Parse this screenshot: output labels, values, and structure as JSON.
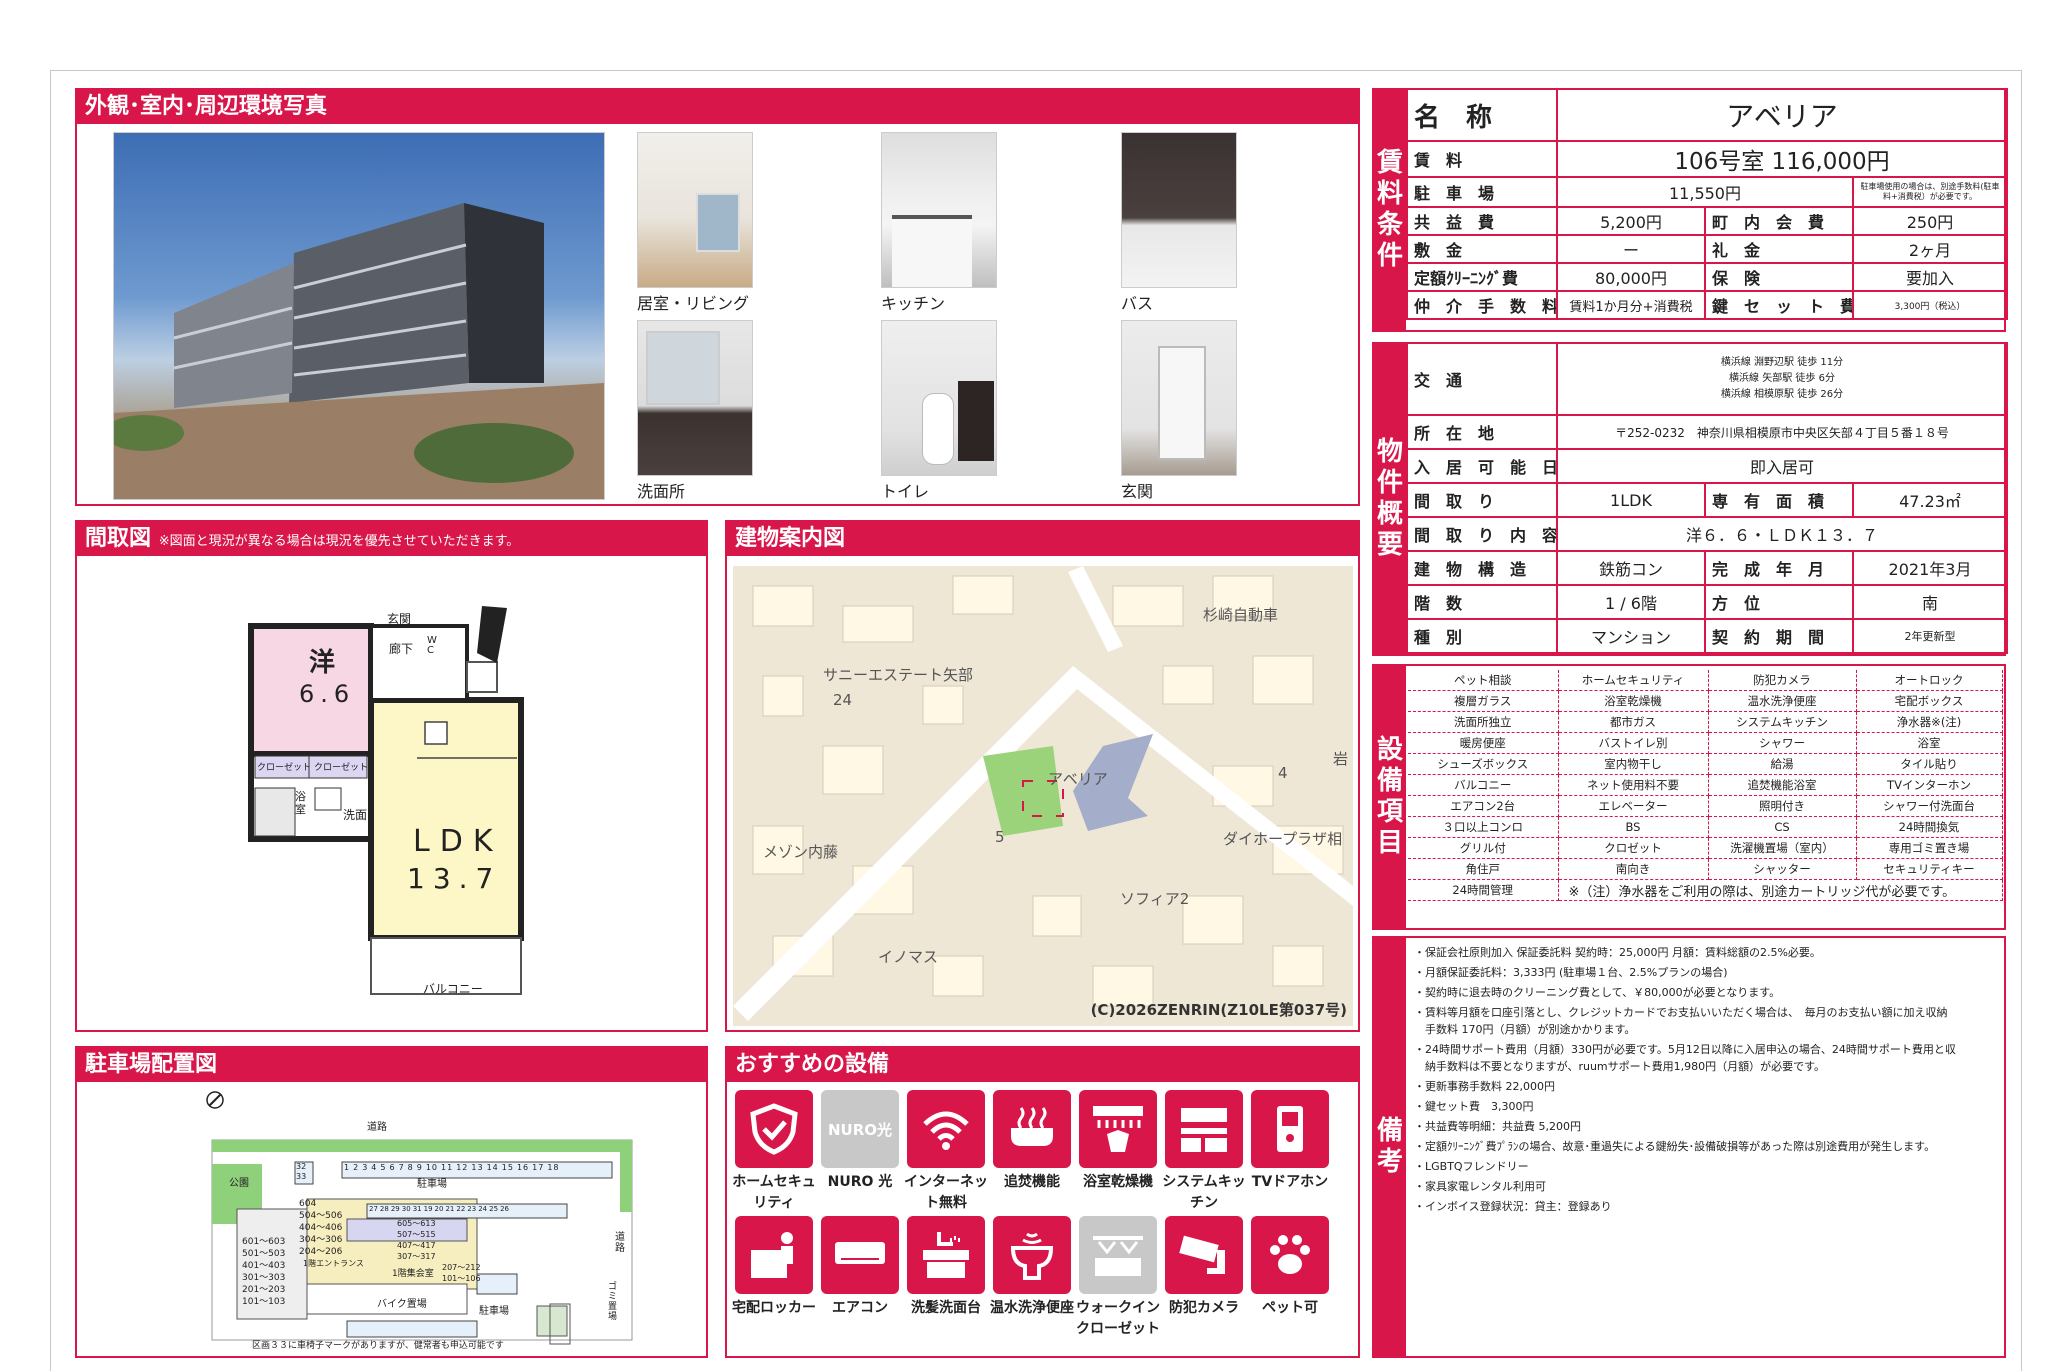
{
  "photos": {
    "title": "外観･室内･周辺環境写真",
    "captions": [
      "居室・リビング",
      "キッチン",
      "バス",
      "洗面所",
      "トイレ",
      "玄関"
    ]
  },
  "floorplan": {
    "title": "間取図",
    "note": "※図面と現況が異なる場合は現況を優先させていただきます。",
    "rooms": {
      "western": "洋",
      "western_size": "6.6",
      "genkan": "玄関",
      "hallway": "廊下",
      "wc": "W C",
      "closet1": "クローゼット",
      "closet2": "クローゼット",
      "bath": "浴 室",
      "washroom": "洗面",
      "ldk": "LDK",
      "ldk_size": "13.7",
      "balcony": "バルコニー"
    }
  },
  "map": {
    "title": "建物案内図",
    "labels": [
      "杉崎自動車",
      "サニーエステート矢部",
      "24",
      "アベリア",
      "5",
      "4",
      "岩",
      "メゾン内藤",
      "ダイホープラザ相",
      "ソフィア2",
      "イノマス"
    ],
    "copyright": "(C)2026ZENRIN(Z10LE第037号)"
  },
  "parking": {
    "title": "駐車場配置図",
    "labels": [
      "道路",
      "公園",
      "駐車場",
      "道路",
      "バイク置場",
      "駐車場",
      "ゴミ置場",
      "1階集会室",
      "1階エントランス"
    ],
    "units_left": [
      "604",
      "504～506",
      "404～406",
      "304～306",
      "204～206"
    ],
    "units_left2": [
      "601～603",
      "501～503",
      "401～403",
      "301～303",
      "201～203",
      "101～103"
    ],
    "units_mid": [
      "605～613",
      "507～515",
      "407～417",
      "307～317",
      "207～212",
      "101～106"
    ],
    "slots_top": [
      "1",
      "2",
      "3",
      "4",
      "5",
      "6",
      "7",
      "8",
      "9",
      "10",
      "11",
      "12",
      "13",
      "14",
      "15",
      "16",
      "17",
      "18"
    ],
    "slots_side": [
      "32",
      "33"
    ],
    "slots_mid": [
      "27",
      "28",
      "29",
      "30",
      "31",
      "19",
      "20",
      "21",
      "22",
      "23",
      "24",
      "25",
      "26"
    ],
    "note": "区画３３に車椅子マークがありますが、健常者も申込可能です"
  },
  "recommend": {
    "title": "おすすめの設備",
    "items": [
      {
        "label": "ホームセキュリティ",
        "icon": "shield-icon"
      },
      {
        "label": "NURO 光",
        "icon": "nuro-logo-icon",
        "badge": "NURO光"
      },
      {
        "label": "インターネット無料",
        "icon": "wifi-icon"
      },
      {
        "label": "追焚機能",
        "icon": "bathtub-icon"
      },
      {
        "label": "浴室乾燥機",
        "icon": "bathroom-dryer-icon"
      },
      {
        "label": "システムキッチン",
        "icon": "kitchen-icon"
      },
      {
        "label": "TVドアホン",
        "icon": "intercom-icon"
      },
      {
        "label": "宅配ロッカー",
        "icon": "delivery-locker-icon"
      },
      {
        "label": "エアコン",
        "icon": "air-conditioner-icon"
      },
      {
        "label": "洗髪洗面台",
        "icon": "vanity-icon"
      },
      {
        "label": "温水洗浄便座",
        "icon": "toilet-icon"
      },
      {
        "label": "ウォークインクローゼット",
        "icon": "closet-icon"
      },
      {
        "label": "防犯カメラ",
        "icon": "camera-icon"
      },
      {
        "label": "ペット可",
        "icon": "paw-icon"
      }
    ]
  },
  "rent": {
    "side": [
      "賃",
      "料",
      "条",
      "件"
    ],
    "name_label": "名　称",
    "name": "アベリア",
    "rent_label": "賃　料",
    "rent": "106号室 116,000円",
    "parking_label": "駐　車　場",
    "parking": "11,550円",
    "parking_note": "駐車場使用の場合は、別途手数料(駐車料+消費税）が必要です。",
    "kyoeki_label": "共　益　費",
    "kyoeki": "5,200円",
    "chonai_label": "町　内　会　費",
    "chonai": "250円",
    "shikikin_label": "敷　金",
    "shikikin": "ー",
    "reikin_label": "礼　金",
    "reikin": "2ヶ月",
    "cleaning_label": "定額ｸﾘｰﾆﾝｸﾞ費",
    "cleaning": "80,000円",
    "hoken_label": "保　険",
    "hoken": "要加入",
    "chukai_label": "仲　介　手　数　料",
    "chukai": "賃料1か月分+消費税",
    "key_label": "鍵　セ　ッ　ト　費",
    "key": "3,300円（税込）"
  },
  "property": {
    "side": [
      "物",
      "件",
      "概",
      "要"
    ],
    "access_label": "交　通",
    "access": [
      "横浜線 淵野辺駅 徒歩 11分",
      "横浜線 矢部駅 徒歩 6分",
      "横浜線 相模原駅 徒歩 26分"
    ],
    "address_label": "所　在　地",
    "address": "〒252-0232　神奈川県相模原市中央区矢部４丁目５番１８号",
    "move_label": "入　居　可　能　日",
    "move": "即入居可",
    "layout_label": "間　取　り",
    "layout": "1LDK",
    "area_label": "専　有　面　積",
    "area": "47.23㎡",
    "detail_label": "間　取　り　内　容",
    "detail": "洋６．６・ＬＤＫ１３．７",
    "structure_label": "建　物　構　造",
    "structure": "鉄筋コン",
    "built_label": "完　成　年　月",
    "built": "2021年3月",
    "floor_label": "階　数",
    "floor": "1 / 6階",
    "direction_label": "方　位",
    "direction": "南",
    "type_label": "種　別",
    "type": "マンション",
    "contract_label": "契　約　期　間",
    "contract": "2年更新型"
  },
  "equipment": {
    "side": [
      "設",
      "備",
      "項",
      "目"
    ],
    "rows": [
      [
        "ペット相談",
        "ホームセキュリティ",
        "防犯カメラ",
        "オートロック"
      ],
      [
        "複層ガラス",
        "浴室乾燥機",
        "温水洗浄便座",
        "宅配ボックス"
      ],
      [
        "洗面所独立",
        "都市ガス",
        "システムキッチン",
        "浄水器※(注)"
      ],
      [
        "暖房便座",
        "バストイレ別",
        "シャワー",
        "浴室"
      ],
      [
        "シューズボックス",
        "室内物干し",
        "給湯",
        "タイル貼り"
      ],
      [
        "バルコニー",
        "ネット使用料不要",
        "追焚機能浴室",
        "TVインターホン"
      ],
      [
        "エアコン2台",
        "エレベーター",
        "照明付き",
        "シャワー付洗面台"
      ],
      [
        "３口以上コンロ",
        "BS",
        "CS",
        "24時間換気"
      ],
      [
        "グリル付",
        "クロゼット",
        "洗濯機置場（室内）",
        "専用ゴミ置き場"
      ],
      [
        "角住戸",
        "南向き",
        "シャッター",
        "セキュリティキー"
      ]
    ],
    "last_first": "24時間管理",
    "last_note": "※（注）浄水器をご利用の際は、別途カートリッジ代が必要です。"
  },
  "remarks": {
    "side": [
      "備",
      "考"
    ],
    "lines": [
      "・保証会社原則加入 保証委託料 契約時：25,000円 月額：賃料総額の2.5%必要。",
      "・月額保証委託料：3,333円 (駐車場１台、2.5%プランの場合)",
      "・契約時に退去時のクリーニング費として、￥80,000が必要となります。",
      "・賃料等月額を口座引落とし、クレジットカードでお支払いいただく場合は、　毎月のお支払い額に加え収納\n　手数料 170円（月額）が別途かかります。",
      "・24時間サポート費用（月額）330円が必要です。5月12日以降に入居申込の場合、24時間サポート費用と収\n　納手数料は不要となりますが、ruumサポート費用1,980円（月額）が必要です。",
      "・更新事務手数料 22,000円",
      "・鍵セット費　3,300円",
      "・共益費等明細：共益費 5,200円",
      "・定額ｸﾘｰﾆﾝｸﾞ費ﾌﾟﾗﾝの場合、故意･重過失による鍵紛失･設備破損等があった際は別途費用が発生します。",
      "・LGBTQフレンドリー",
      "・家具家電レンタル利用可",
      "・インボイス登録状況：貸主：登録あり"
    ]
  }
}
